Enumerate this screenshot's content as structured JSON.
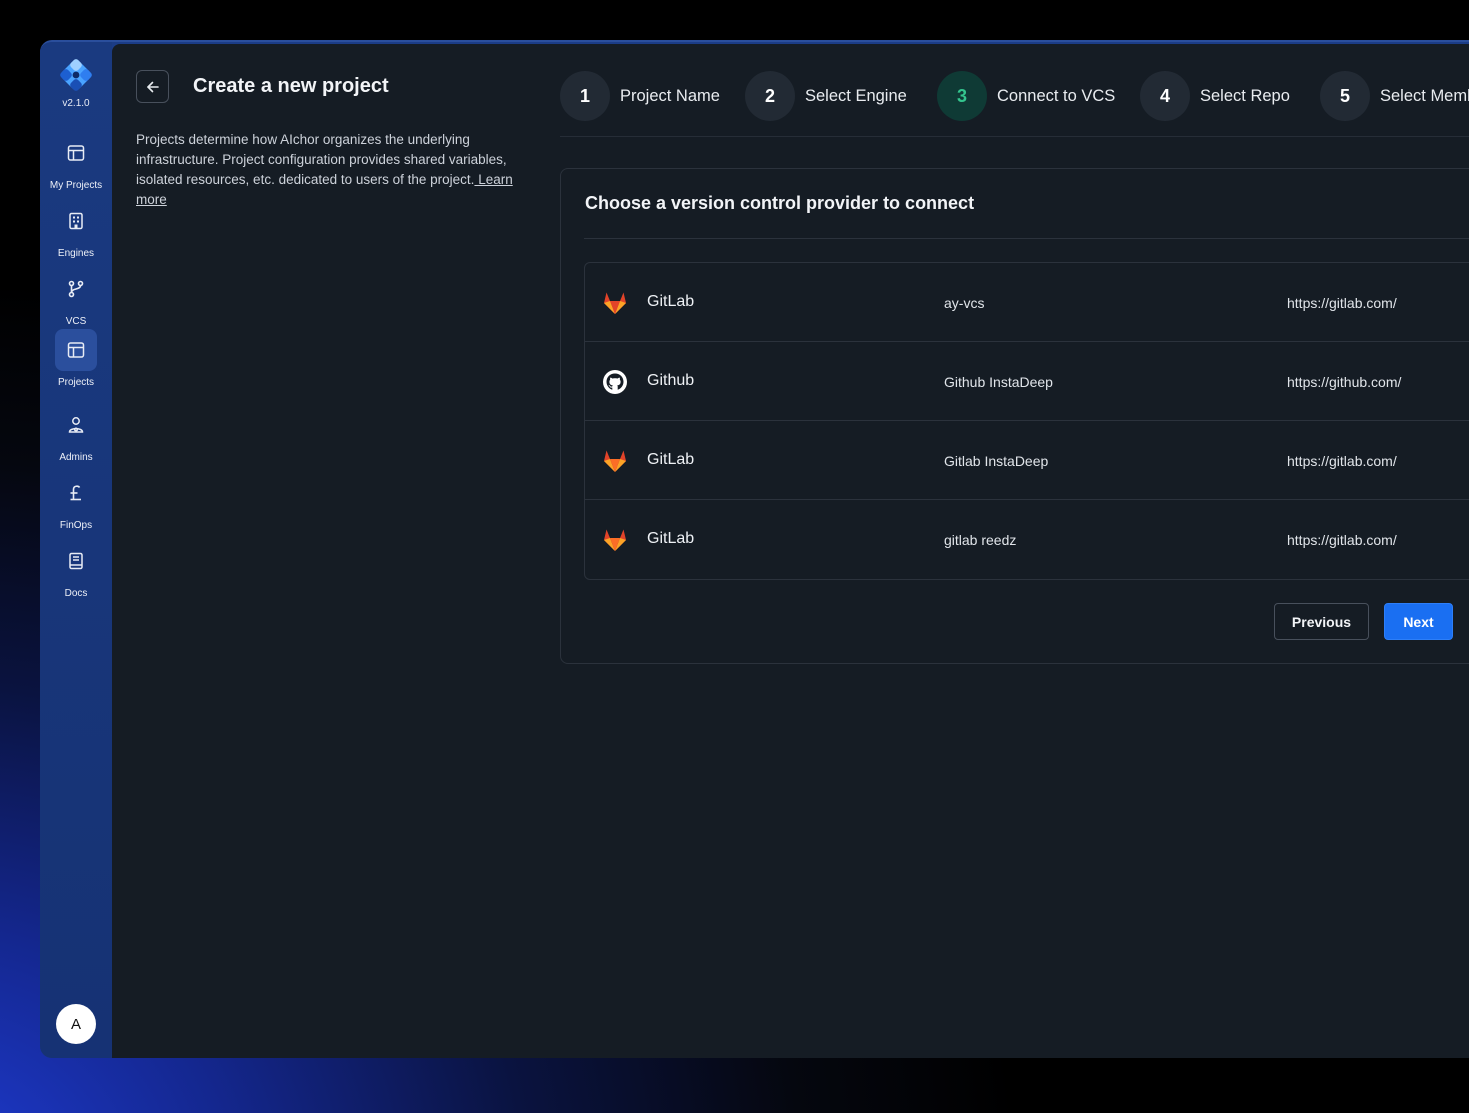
{
  "sidebar": {
    "version": "v2.1.0",
    "items": [
      {
        "label": "My Projects",
        "icon": "layout-icon"
      },
      {
        "label": "Engines",
        "icon": "building-icon"
      },
      {
        "label": "VCS",
        "icon": "git-branch-icon"
      },
      {
        "label": "Projects",
        "icon": "layout-icon"
      },
      {
        "label": "Admins",
        "icon": "users-icon"
      },
      {
        "label": "FinOps",
        "icon": "pound-icon"
      },
      {
        "label": "Docs",
        "icon": "book-icon"
      }
    ],
    "active": "Projects",
    "avatar": "A"
  },
  "header": {
    "title": "Create a new project",
    "description": "Projects determine how AIchor organizes the underlying infrastructure.  Project configuration provides shared variables, isolated resources,  etc. dedicated to users of the project.",
    "learn_more": " Learn more"
  },
  "steps": [
    {
      "num": "1",
      "label": "Project Name"
    },
    {
      "num": "2",
      "label": "Select Engine"
    },
    {
      "num": "3",
      "label": "Connect to VCS"
    },
    {
      "num": "4",
      "label": "Select Repo"
    },
    {
      "num": "5",
      "label": "Select Members"
    }
  ],
  "active_step": "3",
  "card": {
    "title": "Choose a version control provider to connect",
    "providers": [
      {
        "type": "gitlab",
        "name": "GitLab",
        "account": "ay-vcs",
        "url": "https://gitlab.com/"
      },
      {
        "type": "github",
        "name": "Github",
        "account": "Github InstaDeep",
        "url": "https://github.com/"
      },
      {
        "type": "gitlab",
        "name": "GitLab",
        "account": "Gitlab InstaDeep",
        "url": "https://gitlab.com/"
      },
      {
        "type": "gitlab",
        "name": "GitLab",
        "account": "gitlab reedz",
        "url": "https://gitlab.com/"
      }
    ],
    "previous_label": "Previous",
    "next_label": "Next"
  },
  "colors": {
    "sidebar": "#1a3a80",
    "main_bg": "#151c24",
    "active_step": "#34c58e",
    "primary_button": "#1a6ff2"
  }
}
